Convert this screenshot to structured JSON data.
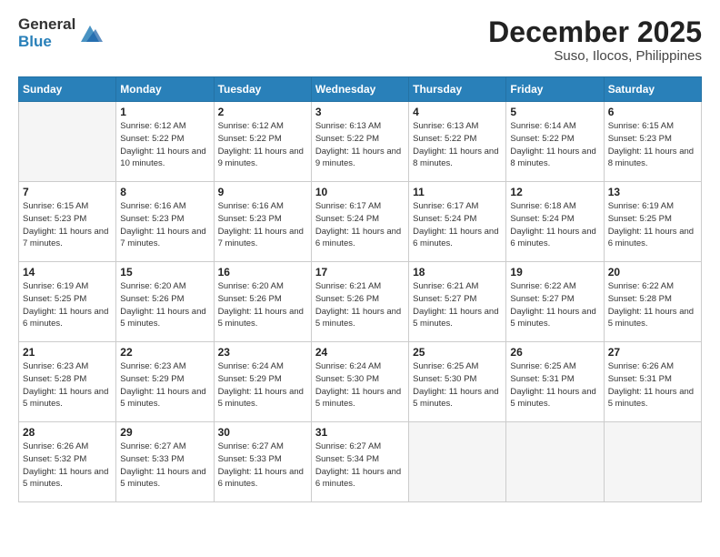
{
  "header": {
    "logo_general": "General",
    "logo_blue": "Blue",
    "month_title": "December 2025",
    "location": "Suso, Ilocos, Philippines"
  },
  "weekdays": [
    "Sunday",
    "Monday",
    "Tuesday",
    "Wednesday",
    "Thursday",
    "Friday",
    "Saturday"
  ],
  "weeks": [
    [
      {
        "day": "",
        "empty": true
      },
      {
        "day": "1",
        "sunrise": "6:12 AM",
        "sunset": "5:22 PM",
        "daylight": "11 hours and 10 minutes."
      },
      {
        "day": "2",
        "sunrise": "6:12 AM",
        "sunset": "5:22 PM",
        "daylight": "11 hours and 9 minutes."
      },
      {
        "day": "3",
        "sunrise": "6:13 AM",
        "sunset": "5:22 PM",
        "daylight": "11 hours and 9 minutes."
      },
      {
        "day": "4",
        "sunrise": "6:13 AM",
        "sunset": "5:22 PM",
        "daylight": "11 hours and 8 minutes."
      },
      {
        "day": "5",
        "sunrise": "6:14 AM",
        "sunset": "5:22 PM",
        "daylight": "11 hours and 8 minutes."
      },
      {
        "day": "6",
        "sunrise": "6:15 AM",
        "sunset": "5:23 PM",
        "daylight": "11 hours and 8 minutes."
      }
    ],
    [
      {
        "day": "7",
        "sunrise": "6:15 AM",
        "sunset": "5:23 PM",
        "daylight": "11 hours and 7 minutes."
      },
      {
        "day": "8",
        "sunrise": "6:16 AM",
        "sunset": "5:23 PM",
        "daylight": "11 hours and 7 minutes."
      },
      {
        "day": "9",
        "sunrise": "6:16 AM",
        "sunset": "5:23 PM",
        "daylight": "11 hours and 7 minutes."
      },
      {
        "day": "10",
        "sunrise": "6:17 AM",
        "sunset": "5:24 PM",
        "daylight": "11 hours and 6 minutes."
      },
      {
        "day": "11",
        "sunrise": "6:17 AM",
        "sunset": "5:24 PM",
        "daylight": "11 hours and 6 minutes."
      },
      {
        "day": "12",
        "sunrise": "6:18 AM",
        "sunset": "5:24 PM",
        "daylight": "11 hours and 6 minutes."
      },
      {
        "day": "13",
        "sunrise": "6:19 AM",
        "sunset": "5:25 PM",
        "daylight": "11 hours and 6 minutes."
      }
    ],
    [
      {
        "day": "14",
        "sunrise": "6:19 AM",
        "sunset": "5:25 PM",
        "daylight": "11 hours and 6 minutes."
      },
      {
        "day": "15",
        "sunrise": "6:20 AM",
        "sunset": "5:26 PM",
        "daylight": "11 hours and 5 minutes."
      },
      {
        "day": "16",
        "sunrise": "6:20 AM",
        "sunset": "5:26 PM",
        "daylight": "11 hours and 5 minutes."
      },
      {
        "day": "17",
        "sunrise": "6:21 AM",
        "sunset": "5:26 PM",
        "daylight": "11 hours and 5 minutes."
      },
      {
        "day": "18",
        "sunrise": "6:21 AM",
        "sunset": "5:27 PM",
        "daylight": "11 hours and 5 minutes."
      },
      {
        "day": "19",
        "sunrise": "6:22 AM",
        "sunset": "5:27 PM",
        "daylight": "11 hours and 5 minutes."
      },
      {
        "day": "20",
        "sunrise": "6:22 AM",
        "sunset": "5:28 PM",
        "daylight": "11 hours and 5 minutes."
      }
    ],
    [
      {
        "day": "21",
        "sunrise": "6:23 AM",
        "sunset": "5:28 PM",
        "daylight": "11 hours and 5 minutes."
      },
      {
        "day": "22",
        "sunrise": "6:23 AM",
        "sunset": "5:29 PM",
        "daylight": "11 hours and 5 minutes."
      },
      {
        "day": "23",
        "sunrise": "6:24 AM",
        "sunset": "5:29 PM",
        "daylight": "11 hours and 5 minutes."
      },
      {
        "day": "24",
        "sunrise": "6:24 AM",
        "sunset": "5:30 PM",
        "daylight": "11 hours and 5 minutes."
      },
      {
        "day": "25",
        "sunrise": "6:25 AM",
        "sunset": "5:30 PM",
        "daylight": "11 hours and 5 minutes."
      },
      {
        "day": "26",
        "sunrise": "6:25 AM",
        "sunset": "5:31 PM",
        "daylight": "11 hours and 5 minutes."
      },
      {
        "day": "27",
        "sunrise": "6:26 AM",
        "sunset": "5:31 PM",
        "daylight": "11 hours and 5 minutes."
      }
    ],
    [
      {
        "day": "28",
        "sunrise": "6:26 AM",
        "sunset": "5:32 PM",
        "daylight": "11 hours and 5 minutes."
      },
      {
        "day": "29",
        "sunrise": "6:27 AM",
        "sunset": "5:33 PM",
        "daylight": "11 hours and 5 minutes."
      },
      {
        "day": "30",
        "sunrise": "6:27 AM",
        "sunset": "5:33 PM",
        "daylight": "11 hours and 6 minutes."
      },
      {
        "day": "31",
        "sunrise": "6:27 AM",
        "sunset": "5:34 PM",
        "daylight": "11 hours and 6 minutes."
      },
      {
        "day": "",
        "empty": true
      },
      {
        "day": "",
        "empty": true
      },
      {
        "day": "",
        "empty": true
      }
    ]
  ]
}
